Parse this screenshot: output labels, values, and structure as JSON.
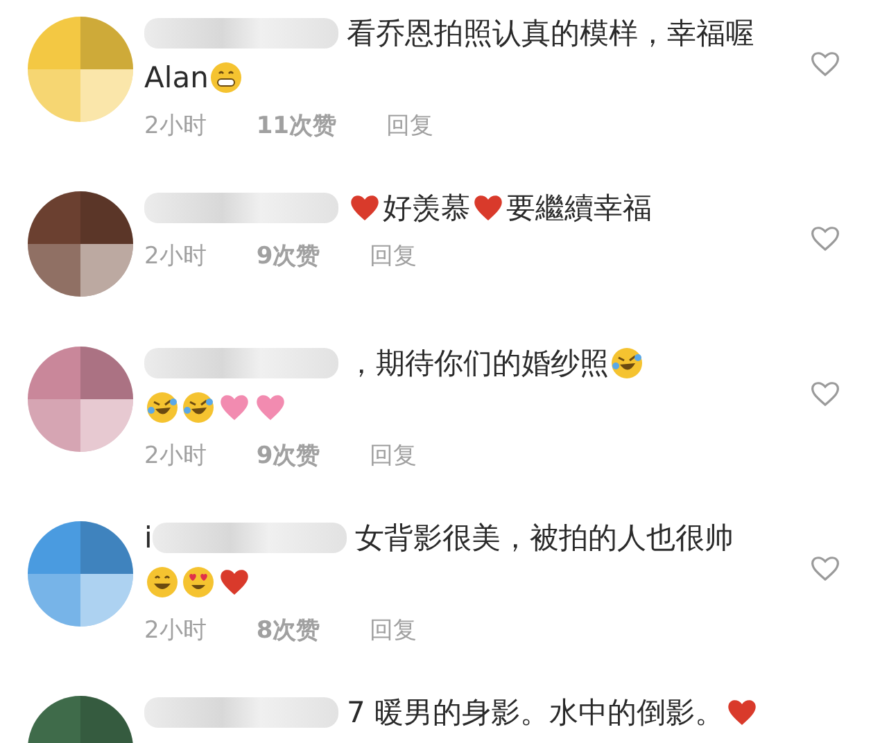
{
  "comments": [
    {
      "lines": [
        [
          {
            "kind": "blur"
          },
          {
            "kind": "text",
            "text": "看乔恩拍照认真的模样，幸福喔"
          }
        ],
        [
          {
            "kind": "text",
            "text": "Alan"
          },
          {
            "kind": "grin"
          }
        ]
      ],
      "meta": {
        "time": "2小时",
        "likes": "11次赞",
        "reply": "回复"
      }
    },
    {
      "lines": [
        [
          {
            "kind": "blur"
          },
          {
            "kind": "heart"
          },
          {
            "kind": "text",
            "text": "好羡慕"
          },
          {
            "kind": "heart"
          },
          {
            "kind": "text",
            "text": "要繼續幸福"
          }
        ]
      ],
      "meta": {
        "time": "2小时",
        "likes": "9次赞",
        "reply": "回复"
      }
    },
    {
      "lines": [
        [
          {
            "kind": "blur"
          },
          {
            "kind": "text",
            "text": "，期待你们的婚纱照"
          },
          {
            "kind": "laugh"
          }
        ],
        [
          {
            "kind": "laugh"
          },
          {
            "kind": "laugh"
          },
          {
            "kind": "pink-heart"
          },
          {
            "kind": "pink-heart"
          }
        ]
      ],
      "meta": {
        "time": "2小时",
        "likes": "9次赞",
        "reply": "回复"
      }
    },
    {
      "lines": [
        [
          {
            "kind": "text",
            "text": "i"
          },
          {
            "kind": "blur"
          },
          {
            "kind": "text",
            "text": "女背影很美，被拍的人也很帅"
          }
        ],
        [
          {
            "kind": "smile"
          },
          {
            "kind": "heart-eyes"
          },
          {
            "kind": "heart"
          }
        ]
      ],
      "meta": {
        "time": "2小时",
        "likes": "8次赞",
        "reply": "回复"
      }
    },
    {
      "lines": [
        [
          {
            "kind": "blur"
          },
          {
            "kind": "text",
            "text": "7 暖男的身影。水中的倒影。"
          },
          {
            "kind": "heart"
          }
        ]
      ]
    }
  ]
}
